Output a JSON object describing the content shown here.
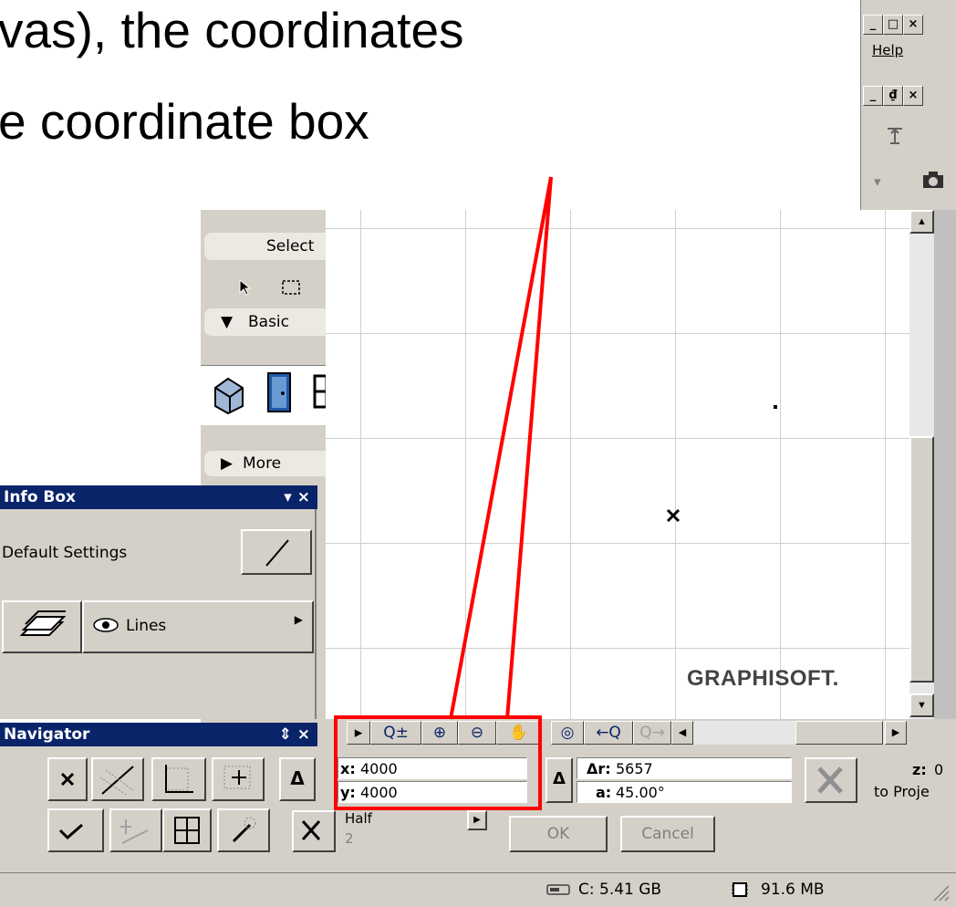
{
  "slide": {
    "line1": "vas), the coordinates",
    "line2": "e coordinate box"
  },
  "window": {
    "help_menu": "Help",
    "controls": {
      "minimize": "_",
      "maximize": "□",
      "close": "×",
      "restore": "₫"
    }
  },
  "toolbox": {
    "select_label": "Select",
    "basic_label": "Basic",
    "more_label": "More"
  },
  "info_box": {
    "title": "Info Box",
    "title_controls": "▾ ×",
    "default_settings": "Default Settings",
    "layer_label": "Lines"
  },
  "navigator": {
    "title": "Navigator",
    "title_controls": "⇕ ×"
  },
  "coordinates": {
    "x_label": "x:",
    "x_value": "4000",
    "y_label": "y:",
    "y_value": "4000",
    "delta_symbol": "Δ",
    "r_label": "Δr:",
    "r_value": "5657",
    "a_label": "a:",
    "a_value": "45.00°",
    "z_label": "z:",
    "z_value": "0",
    "to_project": "to Proje"
  },
  "snap": {
    "mode": "Half",
    "divisor": "2"
  },
  "dialog_buttons": {
    "ok": "OK",
    "cancel": "Cancel"
  },
  "status": {
    "disk": "C: 5.41 GB",
    "memory": "91.6 MB"
  },
  "canvas": {
    "logo_text": "GRAPHISOFT."
  },
  "colors": {
    "highlight": "#ff0000",
    "titlebar": "#0a246a",
    "face": "#d4d0c8"
  }
}
